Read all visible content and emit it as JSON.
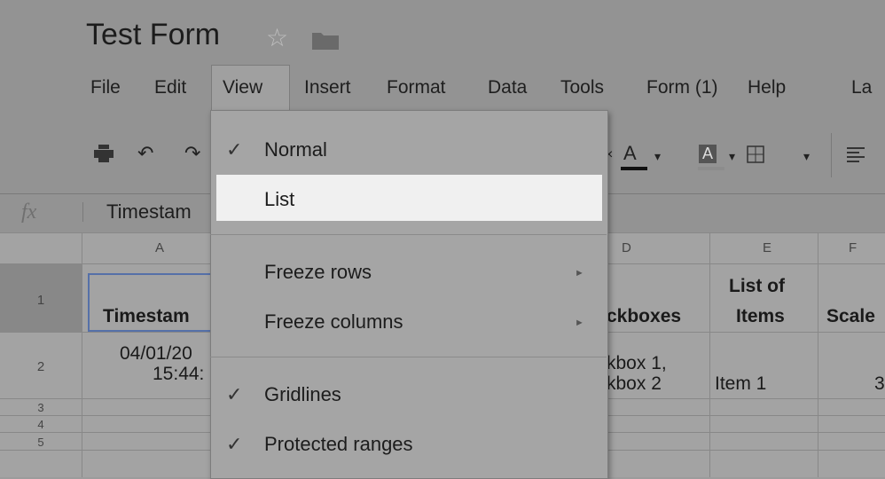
{
  "document": {
    "title": "Test Form"
  },
  "menubar": [
    "File",
    "Edit",
    "View",
    "Insert",
    "Format",
    "Data",
    "Tools",
    "Form (1)",
    "Help",
    "La"
  ],
  "formula_bar": {
    "fx_label": "fx",
    "value": "Timestam"
  },
  "view_menu": {
    "items": [
      {
        "label": "Normal",
        "checked": true
      },
      {
        "label": "List",
        "checked": false
      },
      {
        "label": "Freeze rows",
        "submenu": true
      },
      {
        "label": "Freeze columns",
        "submenu": true
      },
      {
        "label": "Gridlines",
        "checked": true
      },
      {
        "label": "Protected ranges",
        "checked": true
      }
    ],
    "check_glyph": "✓",
    "submenu_glyph": "►"
  },
  "columns": [
    "A",
    "D",
    "E",
    "F"
  ],
  "rows": [
    "1",
    "2",
    "3",
    "4",
    "5"
  ],
  "cells": {
    "a1": "Timestam",
    "d1": "ckboxes",
    "e1_line1": "List of",
    "e1_line2": "Items",
    "f1": "Scale",
    "a2_line1": "04/01/20",
    "a2_line2": "15:44:",
    "d2_line1": "kbox 1,",
    "d2_line2": "kbox 2",
    "e2": "Item 1",
    "f2": "3"
  },
  "toolbar": {
    "text_color_letter": "A",
    "highlight_letter": "A"
  },
  "icons": [
    "star-icon",
    "folder-icon",
    "print-icon",
    "undo-icon",
    "redo-icon",
    "borders-icon",
    "align-icon"
  ]
}
